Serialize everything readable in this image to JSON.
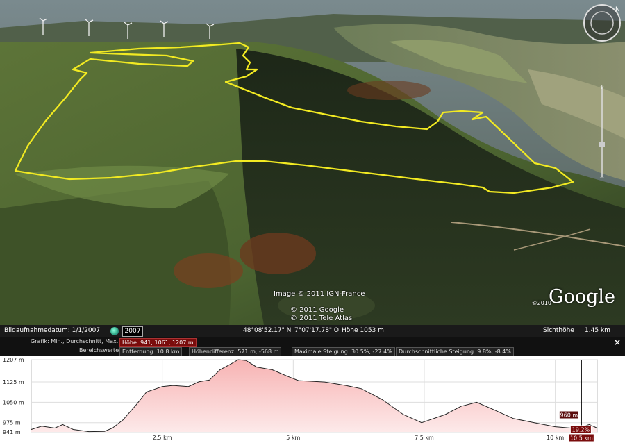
{
  "overlay": {
    "image_credit_1": "Image © 2011 IGN-France",
    "image_credit_2": "© 2011 Google",
    "image_credit_3": "© 2011 Tele Atlas",
    "logo_text": "Google",
    "logo_year": "©2010"
  },
  "statusbar": {
    "imagery_date": "Bildaufnahmedatum: 1/1/2007",
    "year_button": "2007",
    "lat": "48°08'52.17\" N",
    "lon": "7°07'17.78\" O",
    "elevation": "Höhe 1053 m",
    "eye_label": "Sichthöhe",
    "eye_value": "1.45 km"
  },
  "profile": {
    "graph_label": "Grafik: Min., Durchschnitt, Max.",
    "height_value": "Höhe: 941, 1061, 1207 m",
    "range_label": "Bereichswerte:",
    "distance": "Entfernung: 10.8 km",
    "height_diff": "Höhendifferenz: 571 m, -568 m",
    "max_slope": "Maximale Steigung: 30.5%, -27.4%",
    "avg_slope": "Durchschnittliche Steigung: 9.8%, -8.4%",
    "close": "×",
    "cursor_elevation": "960 m",
    "cursor_slope": "19.2%",
    "cursor_distance": "10.5 km"
  },
  "chart_data": {
    "type": "area",
    "y_ticks": [
      "1207 m",
      "1125 m",
      "1050 m",
      "975 m",
      "941 m"
    ],
    "y_tick_values": [
      1207,
      1125,
      1050,
      975,
      941
    ],
    "x_ticks": [
      "2.5 km",
      "5 km",
      "7.5 km",
      "10 km"
    ],
    "x_tick_values": [
      2.5,
      5,
      7.5,
      10
    ],
    "xlim": [
      0,
      10.8
    ],
    "ylim": [
      941,
      1207
    ],
    "x": [
      0,
      0.2,
      0.45,
      0.6,
      0.8,
      1.1,
      1.4,
      1.55,
      1.75,
      2.0,
      2.2,
      2.5,
      2.7,
      3.0,
      3.2,
      3.4,
      3.6,
      3.8,
      3.95,
      4.1,
      4.3,
      4.6,
      4.9,
      5.1,
      5.3,
      5.6,
      6.0,
      6.3,
      6.7,
      7.1,
      7.45,
      7.6,
      7.9,
      8.2,
      8.5,
      8.8,
      9.2,
      9.6,
      10.0,
      10.3,
      10.5,
      10.65,
      10.8
    ],
    "y": [
      950,
      962,
      955,
      968,
      950,
      942,
      943,
      955,
      985,
      1040,
      1088,
      1108,
      1112,
      1108,
      1126,
      1132,
      1170,
      1190,
      1207,
      1204,
      1180,
      1170,
      1145,
      1130,
      1128,
      1125,
      1112,
      1100,
      1060,
      1005,
      975,
      985,
      1005,
      1035,
      1050,
      1025,
      990,
      975,
      960,
      955,
      960,
      968,
      955
    ]
  }
}
